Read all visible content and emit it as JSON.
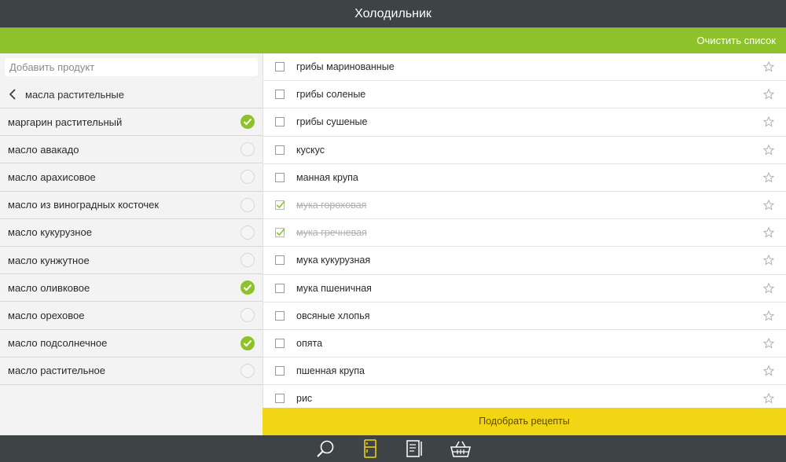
{
  "header": {
    "title": "Холодильник"
  },
  "toolbar": {
    "clear_label": "Очистить список"
  },
  "search": {
    "placeholder": "Добавить продукт"
  },
  "category": {
    "back_label": "масла растительные"
  },
  "categories": [
    {
      "label": "маргарин растительный",
      "checked": true
    },
    {
      "label": "масло авакадо",
      "checked": false
    },
    {
      "label": "масло арахисовое",
      "checked": false
    },
    {
      "label": "масло из виноградных косточек",
      "checked": false
    },
    {
      "label": "масло кукурузное",
      "checked": false
    },
    {
      "label": "масло кунжутное",
      "checked": false
    },
    {
      "label": "масло оливковое",
      "checked": true
    },
    {
      "label": "масло ореховое",
      "checked": false
    },
    {
      "label": "масло подсолнечное",
      "checked": true
    },
    {
      "label": "масло растительное",
      "checked": false
    }
  ],
  "products": [
    {
      "label": "грибы маринованные",
      "checked": false
    },
    {
      "label": "грибы соленые",
      "checked": false
    },
    {
      "label": "грибы сушеные",
      "checked": false
    },
    {
      "label": "кускус",
      "checked": false
    },
    {
      "label": "манная крупа",
      "checked": false
    },
    {
      "label": "мука гороховая",
      "checked": true
    },
    {
      "label": "мука гречневая",
      "checked": true
    },
    {
      "label": "мука кукурузная",
      "checked": false
    },
    {
      "label": "мука пшеничная",
      "checked": false
    },
    {
      "label": "овсяные хлопья",
      "checked": false
    },
    {
      "label": "опята",
      "checked": false
    },
    {
      "label": "пшенная крупа",
      "checked": false
    },
    {
      "label": "рис",
      "checked": false
    }
  ],
  "footer": {
    "recipes_label": "Подобрать рецепты"
  },
  "nav": {
    "icons": [
      "search-icon",
      "fridge-icon",
      "recipe-book-icon",
      "basket-icon"
    ],
    "active": "fridge-icon"
  },
  "colors": {
    "accent_green": "#8dc22a",
    "accent_yellow": "#f3d613",
    "dark_bar": "#3e4346"
  }
}
